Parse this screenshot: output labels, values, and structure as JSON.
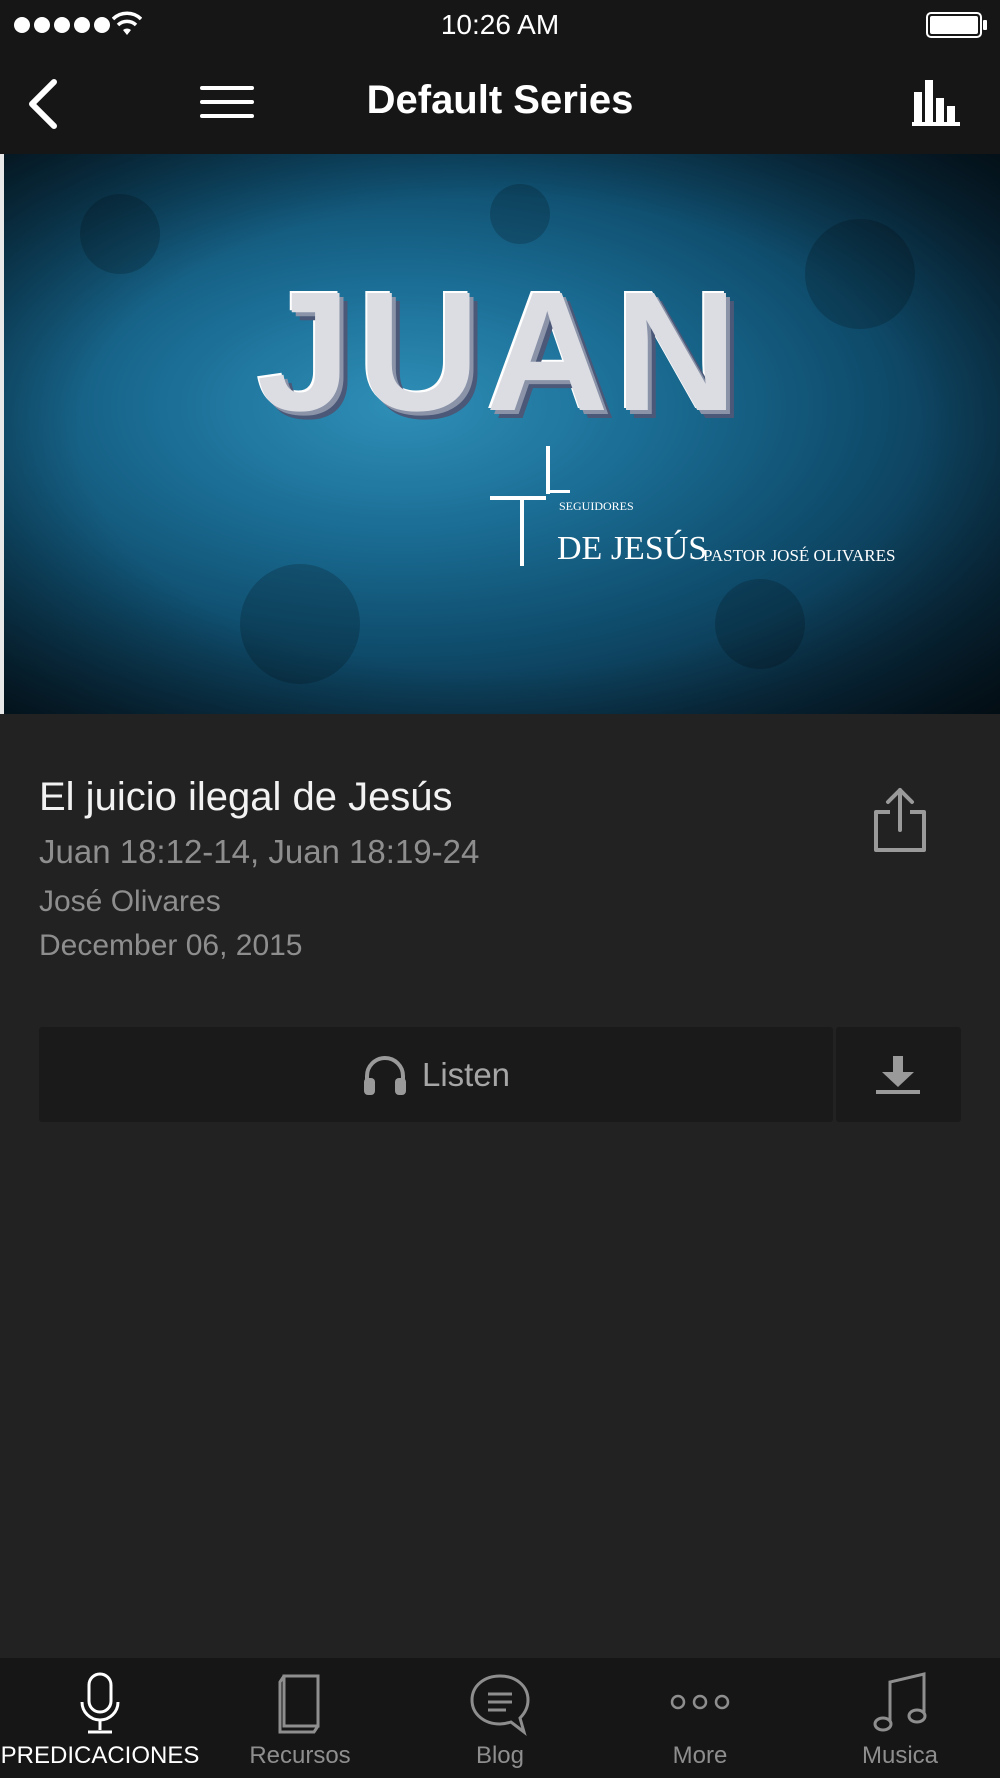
{
  "status_bar": {
    "time": "10:26 AM"
  },
  "nav": {
    "title": "Default Series"
  },
  "hero": {
    "title": "JUAN",
    "small_text": "SEGUIDORES",
    "brand": "DE JESÚS",
    "pastor": "PASTOR JOSÉ OLIVARES"
  },
  "sermon": {
    "title": "El juicio ilegal de Jesús",
    "passage": "Juan 18:12-14, Juan 18:19-24",
    "speaker": "José Olivares",
    "date": "December 06, 2015"
  },
  "actions": {
    "listen_label": "Listen"
  },
  "tabs": [
    {
      "label": "PREDICACIONES",
      "icon": "microphone-icon",
      "active": true
    },
    {
      "label": "Recursos",
      "icon": "book-icon",
      "active": false
    },
    {
      "label": "Blog",
      "icon": "chat-bubble-icon",
      "active": false
    },
    {
      "label": "More",
      "icon": "more-dots-icon",
      "active": false
    },
    {
      "label": "Musica",
      "icon": "music-note-icon",
      "active": false
    }
  ],
  "colors": {
    "background": "#222222",
    "bars": "#161616",
    "secondary_text": "#8e8e8e",
    "button": "#1a1a1a"
  }
}
